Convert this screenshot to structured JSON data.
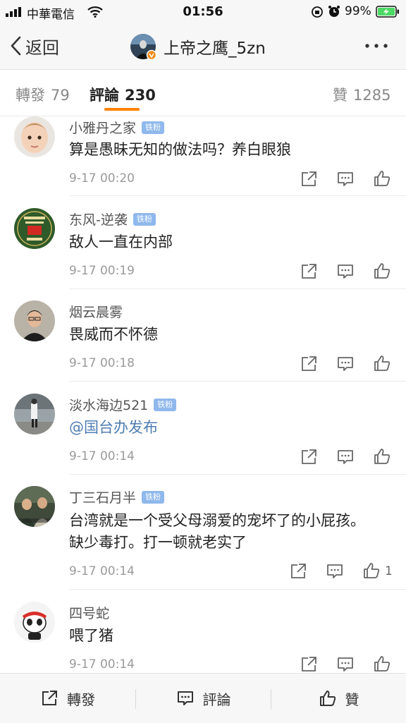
{
  "status_bar": {
    "carrier": "中華電信",
    "time": "01:56",
    "battery": "99%"
  },
  "header": {
    "back_label": "返回",
    "title": "上帝之鹰_5zn"
  },
  "tabs": {
    "repost": {
      "label": "轉發",
      "count": "79"
    },
    "comment": {
      "label": "評論",
      "count": "230"
    },
    "like": {
      "label": "贊",
      "count": "1285"
    }
  },
  "comments": [
    {
      "name": "小雅丹之家",
      "badge": "铁粉",
      "text": "算是愚昧无知的做法吗？养白眼狼",
      "time": "9-17 00:20",
      "likes": ""
    },
    {
      "name": "东风-逆袭",
      "badge": "铁粉",
      "text": "敌人一直在内部",
      "time": "9-17 00:19",
      "likes": ""
    },
    {
      "name": "烟云晨雾",
      "badge": "",
      "text": "畏威而不怀德",
      "time": "9-17 00:18",
      "likes": ""
    },
    {
      "name": "淡水海边521",
      "badge": "铁粉",
      "text": "@国台办发布",
      "time": "9-17 00:14",
      "likes": ""
    },
    {
      "name": "丁三石月半",
      "badge": "铁粉",
      "text": "台湾就是一个受父母溺爱的宠坏了的小屁孩。缺少毒打。打一顿就老实了",
      "time": "9-17 00:14",
      "likes": "1"
    },
    {
      "name": "四号蛇",
      "badge": "",
      "text": "喂了猪",
      "time": "9-17 00:14",
      "likes": ""
    }
  ],
  "bottom_bar": {
    "repost": "轉發",
    "comment": "評論",
    "like": "贊"
  },
  "colors": {
    "accent": "#ff8200",
    "badge": "#8fb8ec",
    "mention": "#4f7db3",
    "battery": "#4cd964"
  }
}
